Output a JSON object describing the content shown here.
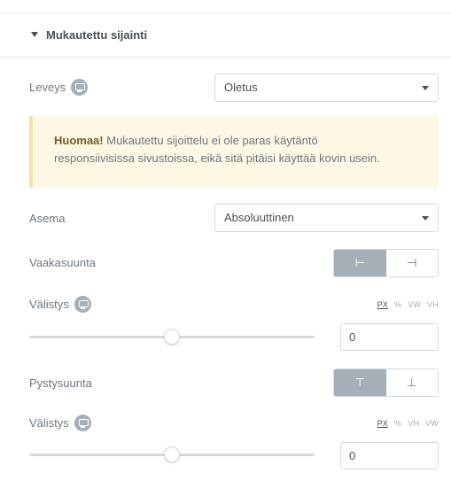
{
  "section": {
    "title": "Mukautettu sijainti"
  },
  "width_row": {
    "label": "Leveys",
    "value": "Oletus"
  },
  "notice": {
    "bold": "Huomaa!",
    "line1": " Mukautettu sijoittelu ei ole paras käytäntö",
    "line2": "responsiivisissa sivustoissa, eikä sitä pitäisi käyttää kovin usein."
  },
  "position_row": {
    "label": "Asema",
    "value": "Absoluuttinen"
  },
  "horizontal": {
    "label": "Vaakasuunta",
    "options": [
      {
        "glyph": "⊢",
        "active": true
      },
      {
        "glyph": "⊣",
        "active": false
      }
    ]
  },
  "horizontal_offset": {
    "label": "Välistys",
    "units": [
      "PX",
      "%",
      "VW",
      "VH"
    ],
    "selected_unit": "PX",
    "slider_fraction": 0.5,
    "value": "0"
  },
  "vertical": {
    "label": "Pystysuunta",
    "options": [
      {
        "glyph": "⊤",
        "active": true
      },
      {
        "glyph": "⊥",
        "active": false
      }
    ]
  },
  "vertical_offset": {
    "label": "Välistys",
    "units": [
      "PX",
      "%",
      "VH",
      "VW"
    ],
    "selected_unit": "PX",
    "slider_fraction": 0.5,
    "value": "0"
  }
}
